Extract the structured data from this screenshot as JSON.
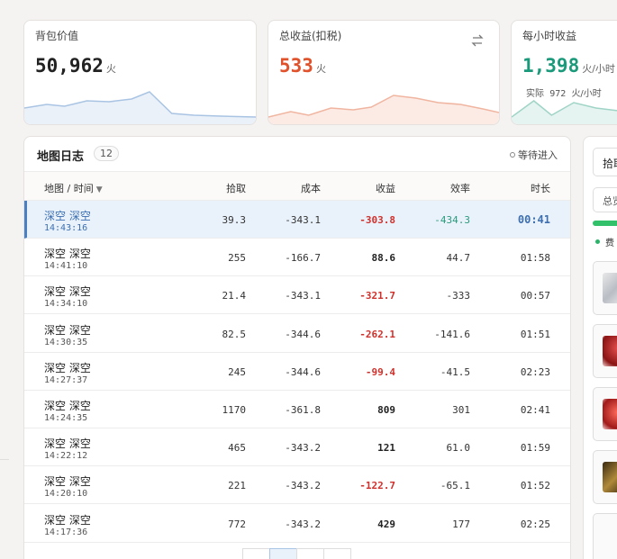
{
  "stats": {
    "backpack": {
      "label": "背包价值",
      "value": "50,962",
      "unit": "火"
    },
    "income": {
      "label": "总收益(扣税)",
      "value": "533",
      "unit": "火",
      "color": "#e0522b"
    },
    "hourly": {
      "label": "每小时收益",
      "value": "1,398",
      "unit": "火/小时",
      "sub_label": "实际",
      "sub_value": "972",
      "sub_unit": "火/小时",
      "color": "#1a9a7a"
    }
  },
  "log": {
    "title": "地图日志",
    "count": "12",
    "status": "等待进入",
    "columns": [
      "地图 / 时间",
      "拾取",
      "成本",
      "收益",
      "效率",
      "时长"
    ],
    "rows": [
      {
        "map": "深空 深空",
        "time": "14:43:16",
        "pickup": "39.3",
        "cost": "-343.1",
        "profit": "-303.8",
        "eff": "-434.3",
        "dur": "00:41"
      },
      {
        "map": "深空 深空",
        "time": "14:41:10",
        "pickup": "255",
        "cost": "-166.7",
        "profit": "88.6",
        "eff": "44.7",
        "dur": "01:58"
      },
      {
        "map": "深空 深空",
        "time": "14:34:10",
        "pickup": "21.4",
        "cost": "-343.1",
        "profit": "-321.7",
        "eff": "-333",
        "dur": "00:57"
      },
      {
        "map": "深空 深空",
        "time": "14:30:35",
        "pickup": "82.5",
        "cost": "-344.6",
        "profit": "-262.1",
        "eff": "-141.6",
        "dur": "01:51"
      },
      {
        "map": "深空 深空",
        "time": "14:27:37",
        "pickup": "245",
        "cost": "-344.6",
        "profit": "-99.4",
        "eff": "-41.5",
        "dur": "02:23"
      },
      {
        "map": "深空 深空",
        "time": "14:24:35",
        "pickup": "1170",
        "cost": "-361.8",
        "profit": "809",
        "eff": "301",
        "dur": "02:41"
      },
      {
        "map": "深空 深空",
        "time": "14:22:12",
        "pickup": "465",
        "cost": "-343.2",
        "profit": "121",
        "eff": "61.0",
        "dur": "01:59"
      },
      {
        "map": "深空 深空",
        "time": "14:20:10",
        "pickup": "221",
        "cost": "-343.2",
        "profit": "-122.7",
        "eff": "-65.1",
        "dur": "01:52"
      },
      {
        "map": "深空 深空",
        "time": "14:17:36",
        "pickup": "772",
        "cost": "-343.2",
        "profit": "429",
        "eff": "177",
        "dur": "02:25"
      }
    ]
  },
  "side": {
    "tab_label": "拾取",
    "filter_label": "总览",
    "progress": 1.0,
    "section_label": "费"
  },
  "colors": {
    "accent": "#4a7fc1",
    "negative": "#d0302b",
    "positive_eff": "#2a9a7c",
    "income": "#e0522b",
    "hourly": "#1a9a7a",
    "progress": "#33c06a"
  }
}
